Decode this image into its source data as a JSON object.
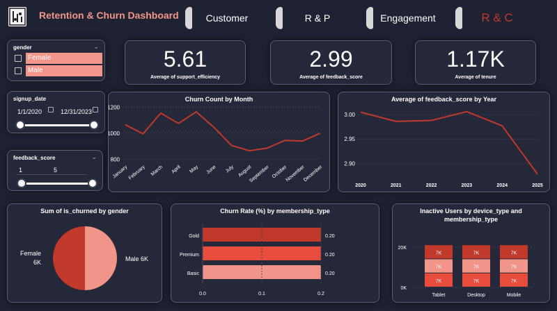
{
  "header": {
    "title": "Retention & Churn Dashboard",
    "tabs": [
      {
        "label": "Customer",
        "color": "#ffffff"
      },
      {
        "label": "R & P",
        "color": "#ffffff"
      },
      {
        "label": "Engagement",
        "color": "#ffffff"
      },
      {
        "label": "R & C",
        "color": "#c0392b"
      }
    ]
  },
  "colors": {
    "background": "#1f2233",
    "card": "#252838",
    "accent": "#f2958a",
    "line": "#c0392b",
    "bar_dark": "#c0392b",
    "bar_mid": "#e74c3c",
    "bar_light": "#f1948a"
  },
  "filters": {
    "gender": {
      "title": "gender",
      "options": [
        "Female",
        "Male"
      ]
    },
    "signup_date": {
      "title": "signup_date",
      "start": "1/1/2020",
      "end": "12/31/2023"
    },
    "feedback_score": {
      "title": "feedback_score",
      "min": "1",
      "max": "5"
    }
  },
  "kpis": [
    {
      "value": "5.61",
      "label": "Average of support_efficiency"
    },
    {
      "value": "2.99",
      "label": "Average of feedback_score"
    },
    {
      "value": "1.17K",
      "label": "Average of tenure"
    }
  ],
  "chart_data": [
    {
      "type": "line",
      "title": "Churn Count by Month",
      "x": [
        "January",
        "February",
        "March",
        "April",
        "May",
        "June",
        "July",
        "August",
        "September",
        "October",
        "November",
        "December"
      ],
      "y": [
        1065,
        995,
        1155,
        1075,
        1165,
        1045,
        905,
        865,
        885,
        945,
        940,
        1000
      ],
      "yticks": [
        "1200",
        "1000",
        "800"
      ],
      "ylim": [
        780,
        1240
      ],
      "grid": true
    },
    {
      "type": "line",
      "title": "Average of feedback_score by Year",
      "x": [
        "2020",
        "2021",
        "2022",
        "2023",
        "2024",
        "2025"
      ],
      "y": [
        3.005,
        2.986,
        2.988,
        3.006,
        2.977,
        2.878
      ],
      "yticks": [
        "3.00",
        "2.95",
        "2.90"
      ],
      "ylim": [
        2.875,
        3.02
      ],
      "grid": true
    },
    {
      "type": "pie",
      "title": "Sum of is_churned by gender",
      "labels": [
        "Female",
        "Male"
      ],
      "value_labels": [
        "6K",
        "6K"
      ],
      "values": [
        50,
        50
      ]
    },
    {
      "type": "bar",
      "title": "Churn Rate (%) by membership_type",
      "categories": [
        "Gold",
        "Premium",
        "Basic"
      ],
      "values": [
        0.2,
        0.2,
        0.2
      ],
      "value_labels": [
        "0.20",
        "0.20",
        "0.20"
      ],
      "xticks": [
        "0.0",
        "0.1",
        "0.2"
      ],
      "xlim": [
        0,
        0.2
      ]
    },
    {
      "type": "bar",
      "title": "Inactive Users by device_type and membership_type",
      "categories": [
        "Tablet",
        "Desktop",
        "Mobile"
      ],
      "series": [
        {
          "values": [
            7,
            7,
            7
          ],
          "labels": [
            "7K",
            "7K",
            "7K"
          ]
        },
        {
          "values": [
            7,
            7,
            7
          ],
          "labels": [
            "7K",
            "7K",
            "7K"
          ]
        },
        {
          "values": [
            7,
            7,
            7
          ],
          "labels": [
            "7K",
            "7K",
            "7K"
          ]
        }
      ],
      "yticks": [
        "20K",
        "0K"
      ],
      "ylim": [
        0,
        20
      ],
      "stacked": true
    }
  ]
}
